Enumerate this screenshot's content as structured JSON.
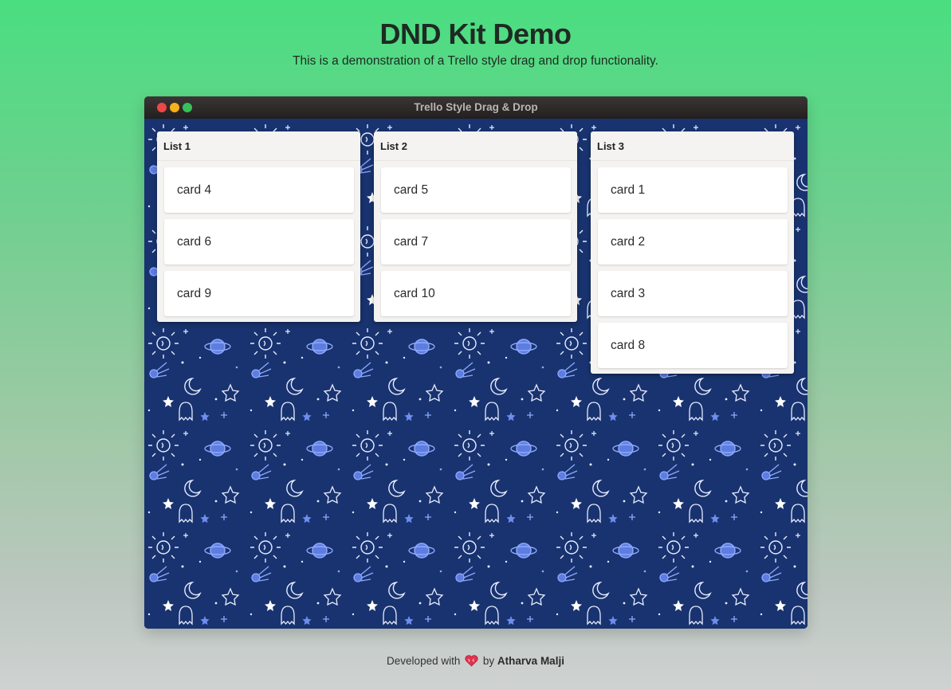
{
  "page": {
    "title": "DND Kit Demo",
    "subtitle": "This is a demonstration of a Trello style drag and drop functionality."
  },
  "window": {
    "title": "Trello Style Drag & Drop",
    "controls": [
      "close",
      "minimize",
      "maximize"
    ]
  },
  "board": {
    "lists": [
      {
        "title": "List 1",
        "cards": [
          "card 4",
          "card 6",
          "card 9"
        ]
      },
      {
        "title": "List 2",
        "cards": [
          "card 5",
          "card 7",
          "card 10"
        ]
      },
      {
        "title": "List 3",
        "cards": [
          "card 1",
          "card 2",
          "card 3",
          "card 8"
        ]
      }
    ]
  },
  "footer": {
    "prefix": "Developed with",
    "icon": "heart-icon",
    "by": "by",
    "author": "Atharva Malji"
  },
  "colors": {
    "gradient_top": "#4ade80",
    "gradient_bottom": "#cfd2d2",
    "board_background": "#18336f",
    "close": "#ee4747",
    "minimize": "#f5b118",
    "maximize": "#37c05a"
  }
}
